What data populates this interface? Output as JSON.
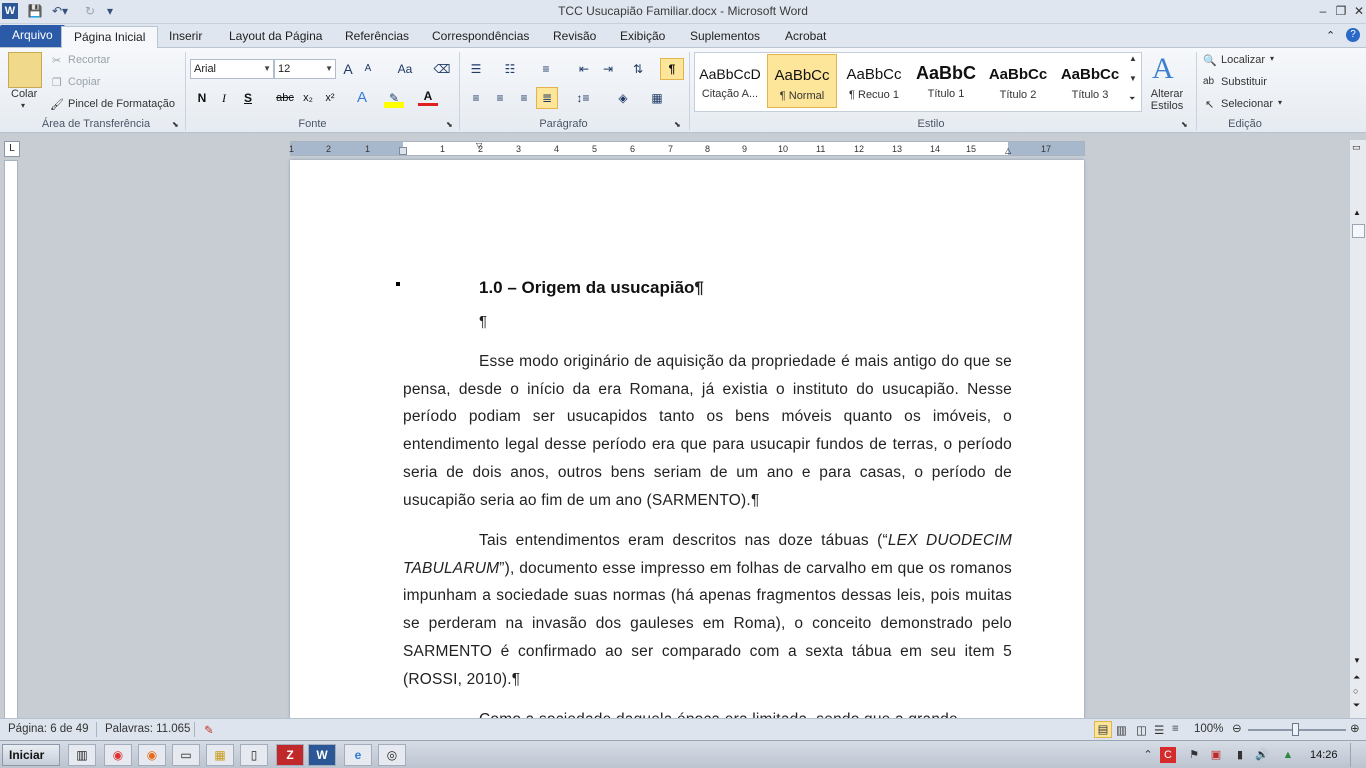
{
  "window": {
    "title": "TCC Usucapião Familiar.docx - Microsoft Word",
    "app_icon": "W"
  },
  "tabs": [
    {
      "label": "Arquivo"
    },
    {
      "label": "Página Inicial"
    },
    {
      "label": "Inserir"
    },
    {
      "label": "Layout da Página"
    },
    {
      "label": "Referências"
    },
    {
      "label": "Correspondências"
    },
    {
      "label": "Revisão"
    },
    {
      "label": "Exibição"
    },
    {
      "label": "Suplementos"
    },
    {
      "label": "Acrobat"
    }
  ],
  "clipboard": {
    "paste": "Colar",
    "cut": "Recortar",
    "copy": "Copiar",
    "format_painter": "Pincel de Formatação",
    "label": "Área de Transferência"
  },
  "font": {
    "name": "Arial",
    "size": "12",
    "label": "Fonte",
    "bold": "N",
    "italic": "I",
    "underline": "S",
    "strike": "abc",
    "sub": "x₂",
    "sup": "x²",
    "grow": "A",
    "shrink": "A",
    "case": "Aa"
  },
  "paragraph": {
    "label": "Parágrafo",
    "pilcrow": "¶"
  },
  "styles": {
    "label": "Estilo",
    "items": [
      {
        "sample": "AaBbCcD",
        "name": "Citação A..."
      },
      {
        "sample": "AaBbCc",
        "name": "¶ Normal"
      },
      {
        "sample": "AaBbCc",
        "name": "¶ Recuo 1"
      },
      {
        "sample": "AaBbC",
        "name": "Título 1"
      },
      {
        "sample": "AaBbCc",
        "name": "Título 2"
      },
      {
        "sample": "AaBbCc",
        "name": "Título 3"
      }
    ],
    "change_styles": "Alterar Estilos"
  },
  "editing": {
    "label": "Edição",
    "find": "Localizar",
    "replace": "Substituir",
    "select": "Selecionar"
  },
  "ruler": {
    "ticks": [
      "1",
      "2",
      "1",
      "1",
      "2",
      "3",
      "4",
      "5",
      "6",
      "7",
      "8",
      "9",
      "10",
      "11",
      "12",
      "13",
      "14",
      "15",
      "17"
    ]
  },
  "document": {
    "heading": "1.0 – Origem da usucapião",
    "para1": "Esse modo originário de aquisição da propriedade é mais antigo do que se pensa, desde o início da era Romana, já existia o instituto do usucapião. Nesse período podiam ser usucapidos tanto os bens móveis quanto os imóveis, o entendimento legal desse período era que para usucapir fundos de terras, o período seria de dois anos, outros bens seriam de um ano e para casas, o período de usucapião seria ao fim de um ano (SARMENTO).",
    "para2_start": "Tais entendimentos eram descritos nas doze tábuas (“",
    "para2_italic": "LEX DUODECIM TABULARUM",
    "para2_end": "”), documento esse impresso em folhas de carvalho em que os romanos impunham a sociedade suas normas (há apenas fragmentos dessas leis, pois muitas se perderam na invasão dos gauleses em Roma), o conceito demonstrado pelo SARMENTO é confirmado ao ser comparado com a sexta tábua em seu item 5 (ROSSI, 2010).",
    "para3": "Como a sociedade daquela época era limitada, sendo que a grande"
  },
  "status": {
    "page": "Página: 6 de 49",
    "words": "Palavras: 11.065",
    "zoom": "100%"
  },
  "taskbar": {
    "start": "Iniciar",
    "clock": "14:26"
  }
}
